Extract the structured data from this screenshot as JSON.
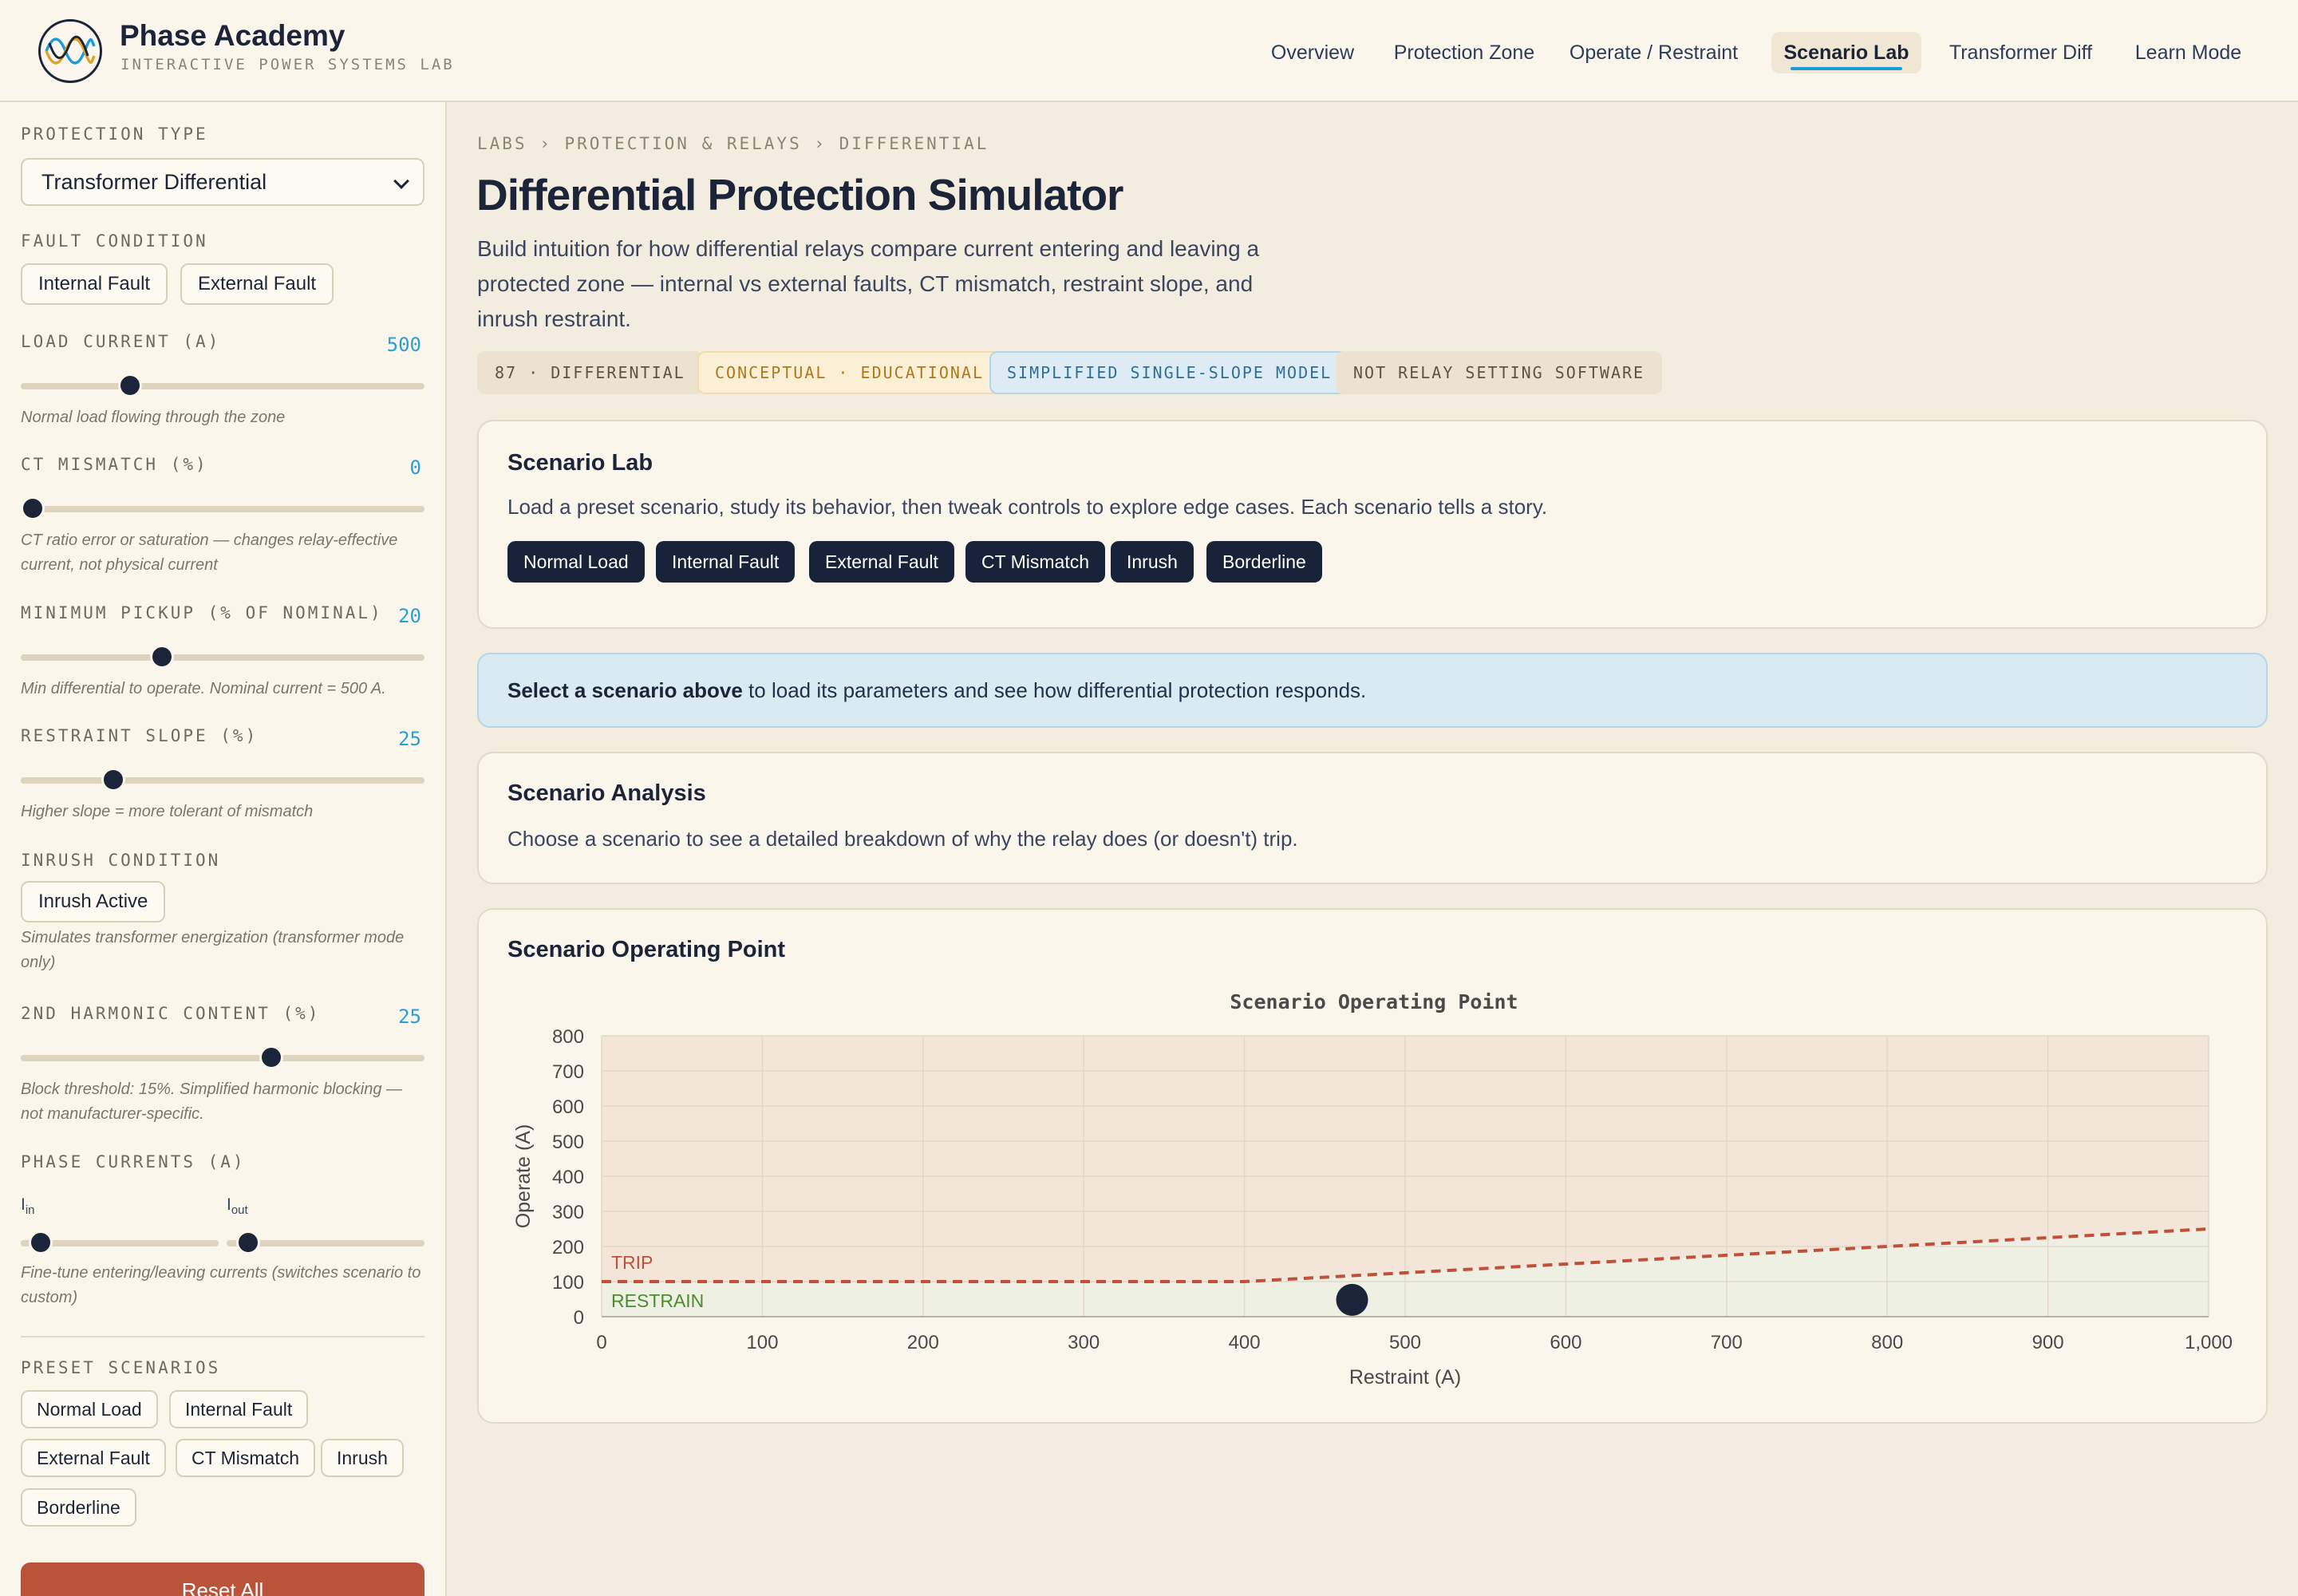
{
  "brand": {
    "title": "Phase Academy",
    "subtitle": "INTERACTIVE POWER SYSTEMS LAB",
    "logo_icon": "sine-wave-logo-icon"
  },
  "nav": {
    "items": [
      {
        "label": "Overview"
      },
      {
        "label": "Protection Zone"
      },
      {
        "label": "Operate / Restraint"
      },
      {
        "label": "Scenario Lab",
        "active": true
      },
      {
        "label": "Transformer Diff"
      },
      {
        "label": "Learn Mode"
      }
    ]
  },
  "sidebar": {
    "protection_type": {
      "label": "PROTECTION TYPE",
      "selected": "Transformer Differential"
    },
    "fault_condition": {
      "label": "FAULT CONDITION",
      "options": [
        "Internal Fault",
        "External Fault"
      ]
    },
    "load_current": {
      "label": "LOAD CURRENT (A)",
      "value": "500",
      "fraction": 0.27,
      "hint": "Normal load flowing through the zone"
    },
    "ct_mismatch": {
      "label": "CT MISMATCH (%)",
      "value": "0",
      "fraction": 0.03,
      "hint": "CT ratio error or saturation — changes relay-effective current, not physical current"
    },
    "min_pickup": {
      "label": "MINIMUM PICKUP (% OF NOMINAL)",
      "value": "20",
      "fraction": 0.35,
      "hint": "Min differential to operate. Nominal current = 500 A."
    },
    "restraint_slope": {
      "label": "RESTRAINT SLOPE (%)",
      "value": "25",
      "fraction": 0.23,
      "hint": "Higher slope = more tolerant of mismatch"
    },
    "inrush": {
      "label": "INRUSH CONDITION",
      "button": "Inrush Active",
      "hint": "Simulates transformer energization (transformer mode only)"
    },
    "harmonic": {
      "label": "2ND HARMONIC CONTENT (%)",
      "value": "25",
      "fraction": 0.62,
      "hint": "Block threshold: 15%. Simplified harmonic blocking — not manufacturer-specific."
    },
    "phase_currents": {
      "label": "PHASE CURRENTS (A)",
      "in_label": "I",
      "in_sub": "in",
      "in_fraction": 0.1,
      "out_label": "I",
      "out_sub": "out",
      "out_fraction": 0.11,
      "hint": "Fine-tune entering/leaving currents (switches scenario to custom)"
    },
    "presets": {
      "label": "PRESET SCENARIOS",
      "items": [
        "Normal Load",
        "Internal Fault",
        "External Fault",
        "CT Mismatch",
        "Inrush",
        "Borderline"
      ]
    },
    "reset": "Reset All"
  },
  "main": {
    "breadcrumb": "LABS › PROTECTION & RELAYS › DIFFERENTIAL",
    "title": "Differential Protection Simulator",
    "description": "Build intuition for how differential relays compare current entering and leaving a protected zone — internal vs external faults, CT mismatch, restraint slope, and inrush restraint.",
    "tags": [
      {
        "label": "87 · DIFFERENTIAL",
        "color": "#5a5546",
        "bg": "#ebe2cf",
        "border": "#ebe2cf"
      },
      {
        "label": "CONCEPTUAL · EDUCATIONAL",
        "color": "#b0781a",
        "bg": "#fbf0d6",
        "border": "#f2dcae"
      },
      {
        "label": "SIMPLIFIED SINGLE-SLOPE MODEL",
        "color": "#2f6f96",
        "bg": "#dcebf4",
        "border": "#b5d4e6"
      },
      {
        "label": "NOT RELAY SETTING SOFTWARE",
        "color": "#5a5546",
        "bg": "#ebe2cf",
        "border": "#ebe2cf"
      }
    ],
    "scenario_lab": {
      "title": "Scenario Lab",
      "text": "Load a preset scenario, study its behavior, then tweak controls to explore edge cases. Each scenario tells a story.",
      "buttons": [
        "Normal Load",
        "Internal Fault",
        "External Fault",
        "CT Mismatch",
        "Inrush",
        "Borderline"
      ]
    },
    "banner": {
      "bold": "Select a scenario above",
      "rest": " to load its parameters and see how differential protection responds."
    },
    "analysis": {
      "title": "Scenario Analysis",
      "text": "Choose a scenario to see a detailed breakdown of why the relay does (or doesn't) trip."
    },
    "operating_point": {
      "title": "Scenario Operating Point"
    }
  },
  "chart_data": {
    "type": "line",
    "title": "Scenario Operating Point",
    "xlabel": "Restraint (A)",
    "ylabel": "Operate (A)",
    "xlim": [
      0,
      1000
    ],
    "ylim": [
      0,
      800
    ],
    "xticks": [
      0,
      100,
      200,
      300,
      400,
      500,
      600,
      700,
      800,
      900,
      1000
    ],
    "xtick_labels": [
      "0",
      "100",
      "200",
      "300",
      "400",
      "500",
      "600",
      "700",
      "800",
      "900",
      "1,000"
    ],
    "yticks": [
      0,
      100,
      200,
      300,
      400,
      500,
      600,
      700,
      800
    ],
    "grid": true,
    "region_labels": {
      "trip": "TRIP",
      "restrain": "RESTRAIN"
    },
    "trip_line": {
      "x": [
        0,
        400,
        1000
      ],
      "y": [
        100,
        100,
        250
      ],
      "color": "#c0503a",
      "style": "dashed"
    },
    "operating_point": {
      "x": 467,
      "y": 48,
      "color": "#1b2438"
    },
    "colors": {
      "trip_region": "#f3e6d8",
      "restrain_region": "#eef0e4",
      "trip_text": "#b9533a",
      "restrain_text": "#4e8a2e"
    }
  }
}
